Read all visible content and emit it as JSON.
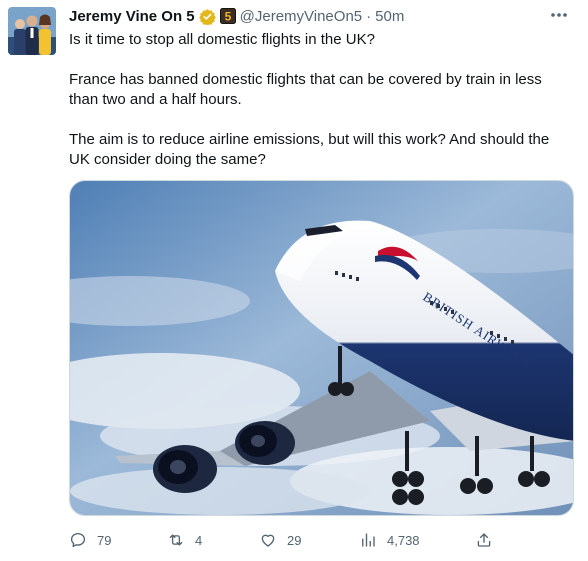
{
  "author": {
    "display_name": "Jeremy Vine On 5",
    "affiliate_badge": "5",
    "handle": "@JeremyVineOn5",
    "separator": "·",
    "time": "50m"
  },
  "tweet": {
    "paragraphs": [
      "Is it time to stop all domestic flights in the UK?",
      "France has banned domestic flights that can be covered by train in less than two and a half hours.",
      "The aim is to reduce airline emissions, but will this work? And should the UK consider doing the same?"
    ]
  },
  "media": {
    "tail_text": "BRITISH AIRWAYS"
  },
  "actions": {
    "replies": "79",
    "retweets": "4",
    "likes": "29",
    "views": "4,738"
  },
  "colors": {
    "accent": "#1d9bf0",
    "verified_gold": "#e2b719",
    "muted": "#536471"
  }
}
